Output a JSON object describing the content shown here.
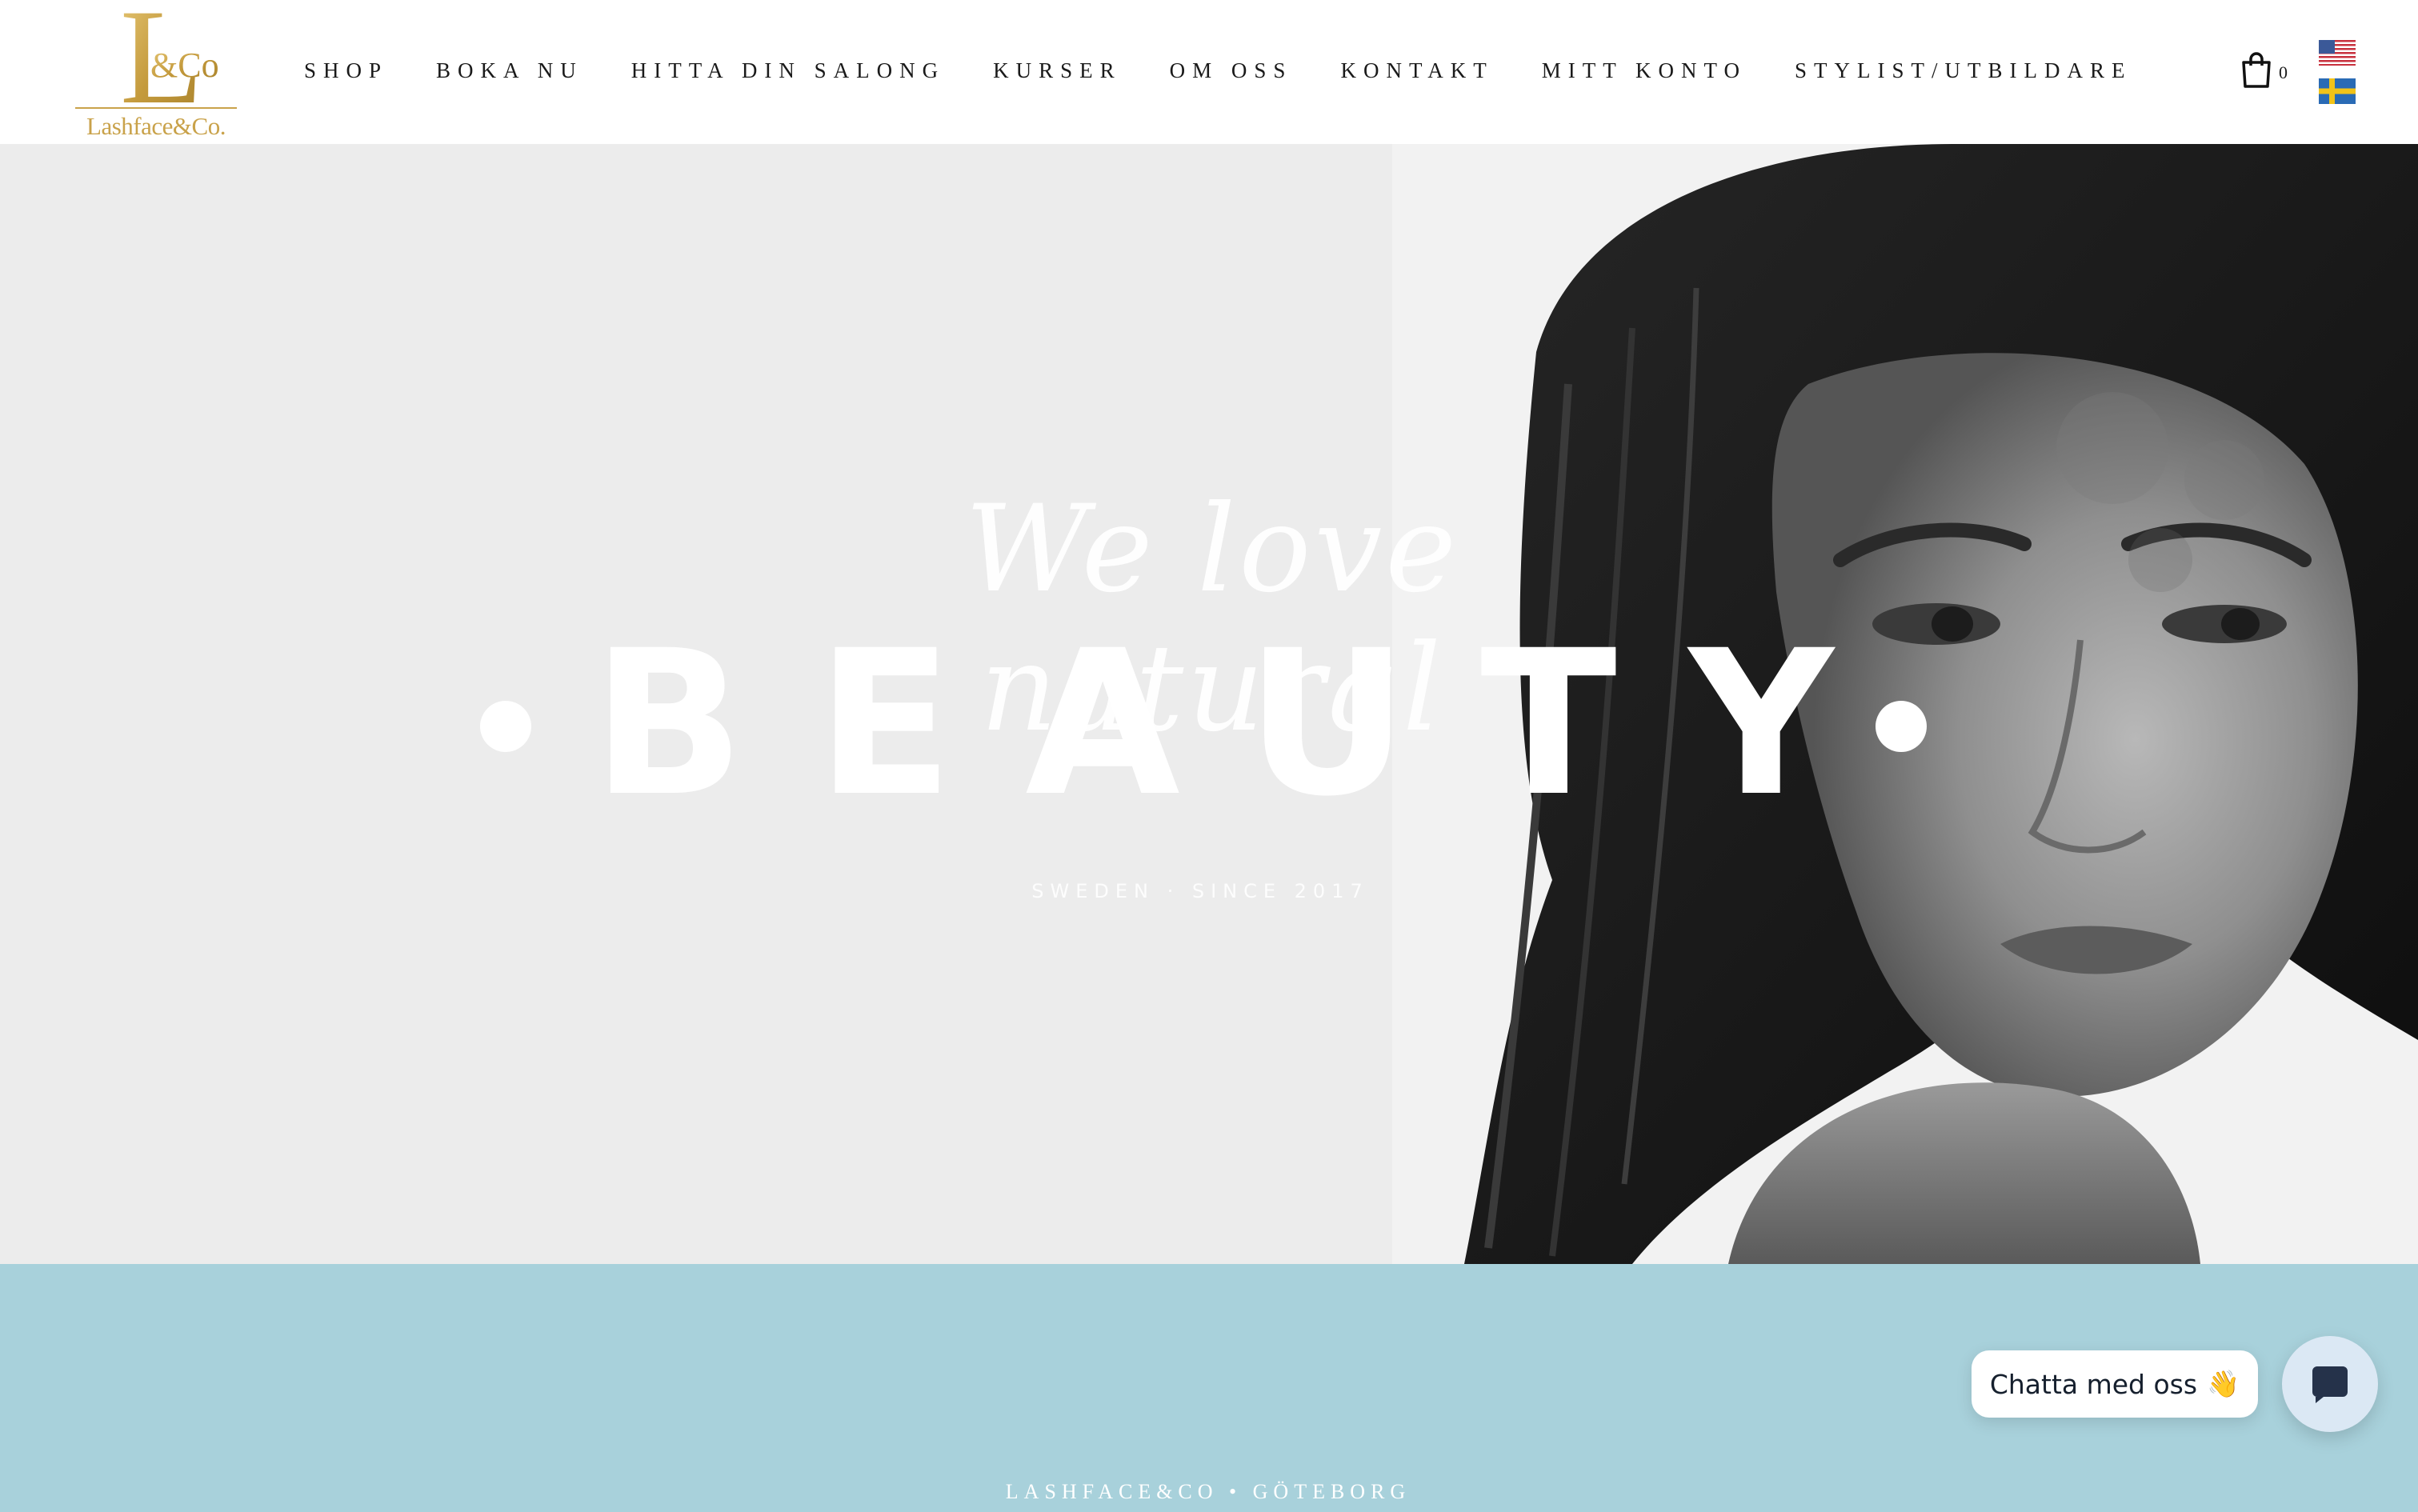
{
  "brand": {
    "logo_letter": "L",
    "logo_amp": "&Co",
    "logo_text": "Lashface&Co.",
    "gold": "#c9a24a"
  },
  "nav": {
    "items": [
      {
        "label": "SHOP"
      },
      {
        "label": "BOKA NU"
      },
      {
        "label": "HITTA DIN SALONG"
      },
      {
        "label": "KURSER"
      },
      {
        "label": "OM OSS"
      },
      {
        "label": "KONTAKT"
      },
      {
        "label": "MITT KONTO"
      },
      {
        "label": "STYLIST/UTBILDARE"
      }
    ]
  },
  "cart": {
    "icon": "shopping-bag-icon",
    "count": "0"
  },
  "languages": [
    {
      "icon": "us-flag-icon"
    },
    {
      "icon": "se-flag-icon"
    }
  ],
  "hero": {
    "script": "We love natural",
    "headline": "BEAUTY",
    "subline": "SWEDEN · SINCE 2017",
    "background": "#ececec"
  },
  "band": {
    "text": "LASHFACE&CO • GÖTEBORG",
    "color": "#a8d1db"
  },
  "chat": {
    "label": "Chatta med oss",
    "emoji": "👋",
    "icon": "chat-bubble-icon"
  }
}
